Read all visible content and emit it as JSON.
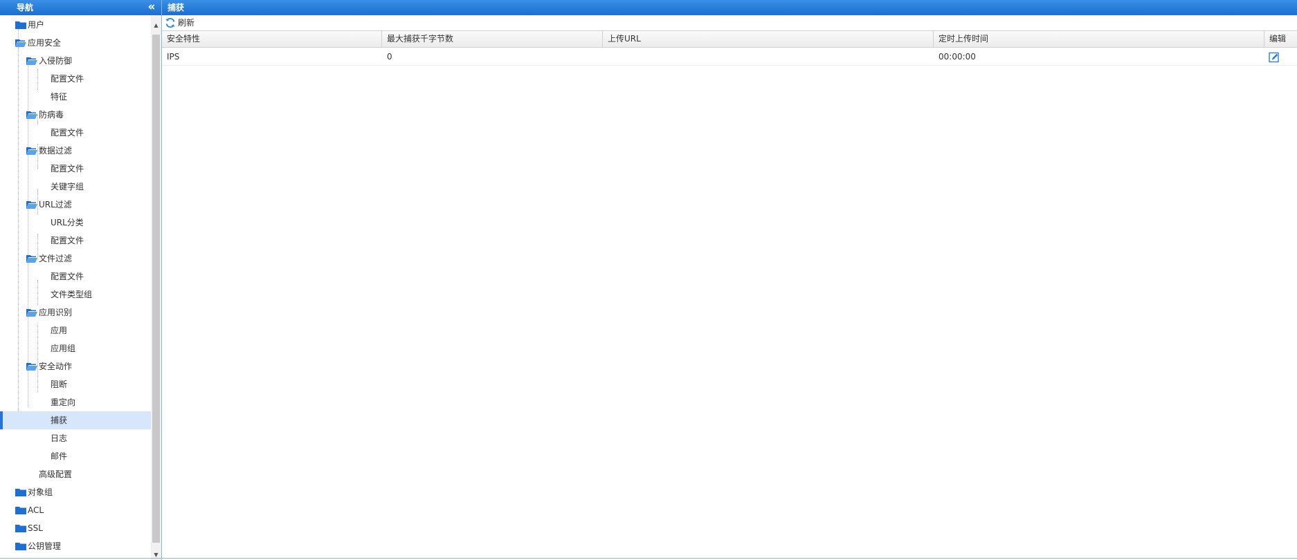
{
  "nav": {
    "title": "导航",
    "collapse_icon": "double-chevron-left-icon",
    "items": [
      {
        "label": "用户",
        "type": "folder"
      },
      {
        "label": "应用安全",
        "type": "folder-open"
      },
      {
        "label": "入侵防御",
        "type": "folder-open"
      },
      {
        "label": "配置文件",
        "type": "leaf"
      },
      {
        "label": "特征",
        "type": "leaf"
      },
      {
        "label": "防病毒",
        "type": "folder-open"
      },
      {
        "label": "配置文件",
        "type": "leaf"
      },
      {
        "label": "数据过滤",
        "type": "folder-open"
      },
      {
        "label": "配置文件",
        "type": "leaf"
      },
      {
        "label": "关键字组",
        "type": "leaf"
      },
      {
        "label": "URL过滤",
        "type": "folder-open"
      },
      {
        "label": "URL分类",
        "type": "leaf"
      },
      {
        "label": "配置文件",
        "type": "leaf"
      },
      {
        "label": "文件过滤",
        "type": "folder-open"
      },
      {
        "label": "配置文件",
        "type": "leaf"
      },
      {
        "label": "文件类型组",
        "type": "leaf"
      },
      {
        "label": "应用识别",
        "type": "folder-open"
      },
      {
        "label": "应用",
        "type": "leaf"
      },
      {
        "label": "应用组",
        "type": "leaf"
      },
      {
        "label": "安全动作",
        "type": "folder-open"
      },
      {
        "label": "阻断",
        "type": "leaf"
      },
      {
        "label": "重定向",
        "type": "leaf"
      },
      {
        "label": "捕获",
        "type": "leaf",
        "selected": true
      },
      {
        "label": "日志",
        "type": "leaf"
      },
      {
        "label": "邮件",
        "type": "leaf"
      },
      {
        "label": "高级配置",
        "type": "leaf"
      },
      {
        "label": "对象组",
        "type": "folder"
      },
      {
        "label": "ACL",
        "type": "folder"
      },
      {
        "label": "SSL",
        "type": "folder"
      },
      {
        "label": "公钥管理",
        "type": "folder"
      }
    ]
  },
  "main": {
    "title": "捕获",
    "toolbar": {
      "refresh_label": "刷新",
      "refresh_icon": "refresh-icon"
    },
    "columns": [
      "安全特性",
      "最大捕获千字节数",
      "上传URL",
      "定时上传时间",
      "编辑"
    ],
    "rows": [
      {
        "feature": "IPS",
        "max_kb": "0",
        "upload_url": "",
        "upload_time": "00:00:00",
        "edit_icon": "edit-icon"
      }
    ]
  },
  "colors": {
    "header_blue": "#1a6fd0",
    "folder_blue": "#1e6fd4",
    "selected_bg": "#d6e6fb",
    "selected_bar": "#2673d9"
  }
}
